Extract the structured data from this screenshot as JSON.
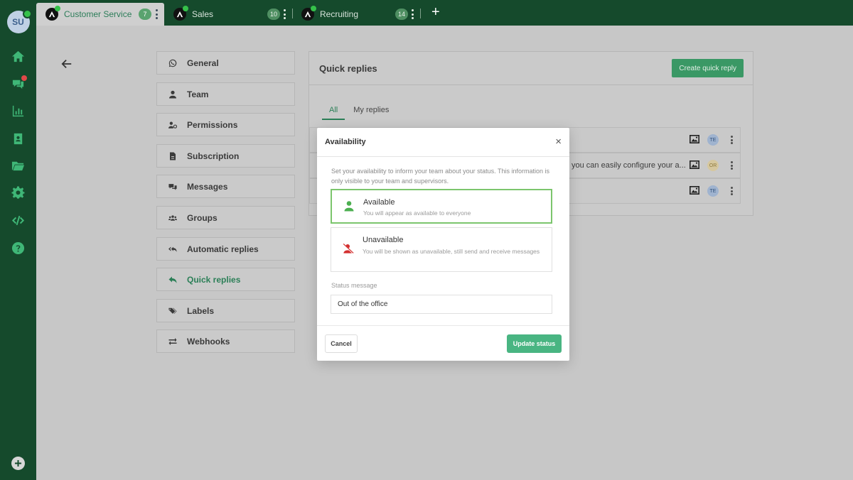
{
  "user": {
    "initials": "SU"
  },
  "workspace_tabs": [
    {
      "label": "Customer Service",
      "count": "7"
    },
    {
      "label": "Sales",
      "count": "10"
    },
    {
      "label": "Recruiting",
      "count": "14"
    }
  ],
  "add_tab_label": "+",
  "settings_menu": [
    {
      "label": "General",
      "icon": "whatsapp-icon"
    },
    {
      "label": "Team",
      "icon": "user-icon"
    },
    {
      "label": "Permissions",
      "icon": "user-cog-icon"
    },
    {
      "label": "Subscription",
      "icon": "file-icon"
    },
    {
      "label": "Messages",
      "icon": "comments-icon"
    },
    {
      "label": "Groups",
      "icon": "users-icon"
    },
    {
      "label": "Automatic replies",
      "icon": "reply-all-icon"
    },
    {
      "label": "Quick replies",
      "icon": "reply-icon",
      "active": true
    },
    {
      "label": "Labels",
      "icon": "tags-icon"
    },
    {
      "label": "Webhooks",
      "icon": "exchange-icon"
    }
  ],
  "panel": {
    "title": "Quick replies",
    "create_button": "Create quick reply",
    "tabs": [
      "All",
      "My replies"
    ],
    "rows": [
      {
        "text": "",
        "initials": "TE"
      },
      {
        "text": "you can easily configure your a...",
        "initials": "OR"
      },
      {
        "text": "",
        "initials": "TE"
      }
    ]
  },
  "modal": {
    "title": "Availability",
    "close_label": "×",
    "description": "Set your availability to inform your team about your status. This information is only visible to your team and supervisors.",
    "options": [
      {
        "title": "Available",
        "subtitle": "You will appear as available to everyone",
        "selected": true
      },
      {
        "title": "Unavailable",
        "subtitle": "You will be shown as unavailable, still send and receive messages",
        "selected": false
      }
    ],
    "status_label": "Status message",
    "status_value": "Out of the office",
    "cancel_label": "Cancel",
    "update_label": "Update status"
  },
  "colors": {
    "sidebar": "#154a2c",
    "accent": "#49b582",
    "available": "#4caf50",
    "unavailable": "#d32f2f"
  }
}
